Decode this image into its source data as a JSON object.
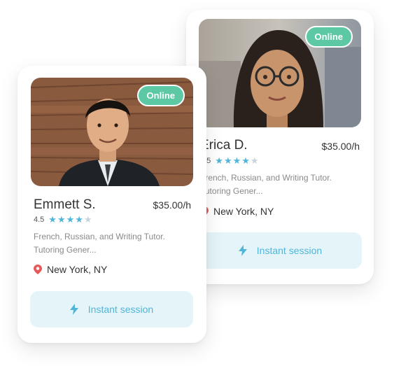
{
  "cards": [
    {
      "name": "Erica D.",
      "price": "$35.00/h",
      "rating": "4.5",
      "stars": "★★★★",
      "star_empty": "★",
      "description": "French, Russian, and Writing Tutor. Tutoring Gener...",
      "location": "New York, NY",
      "status": "Online",
      "action_label": "Instant session"
    },
    {
      "name": "Emmett S.",
      "price": "$35.00/h",
      "rating": "4.5",
      "stars": "★★★★",
      "star_empty": "★",
      "description": "French, Russian, and Writing Tutor. Tutoring Gener...",
      "location": "New York, NY",
      "status": "Online",
      "action_label": "Instant session"
    }
  ],
  "colors": {
    "online": "#5cc8a4",
    "accent": "#4fb6d9",
    "button_bg": "#e4f4f8",
    "pin": "#e85a5a"
  },
  "icons": {
    "location": "map-pin-icon",
    "action": "lightning-bolt-icon",
    "rating": "star-icon"
  }
}
